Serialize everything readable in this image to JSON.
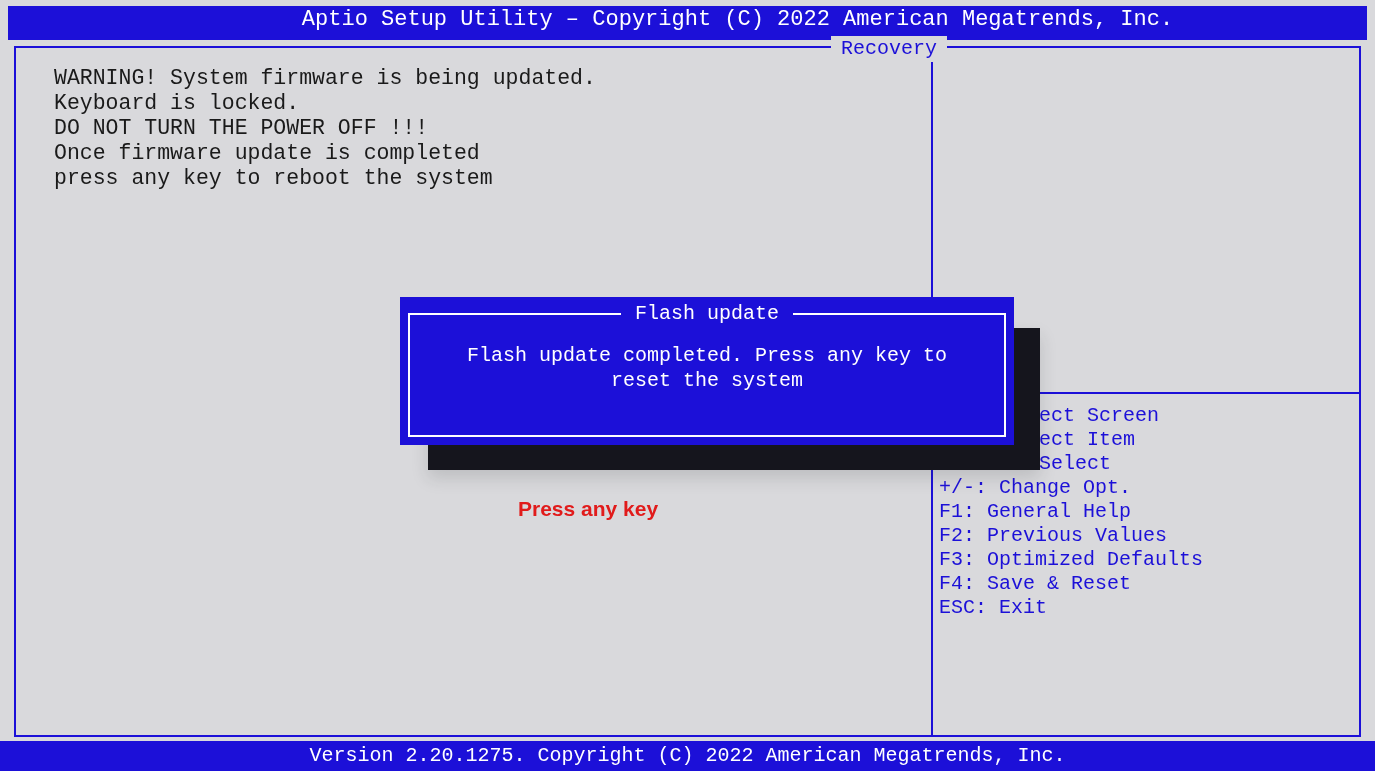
{
  "header": {
    "title": "Aptio Setup Utility – Copyright (C) 2022 American Megatrends, Inc.",
    "tabs": [
      {
        "label": "Recovery",
        "selected": true
      }
    ]
  },
  "message_lines": [
    "WARNING! System firmware is being updated.",
    "Keyboard is locked.",
    "DO NOT TURN THE POWER OFF !!!",
    "Once firmware update is completed",
    "press any key to reboot the system"
  ],
  "help_keys": [
    {
      "text": "ect Screen",
      "covered": true
    },
    {
      "text": "ect Item",
      "covered": true
    },
    {
      "text": "Select",
      "covered": true
    },
    {
      "text": "+/-: Change Opt.",
      "covered": false
    },
    {
      "text": "F1: General Help",
      "covered": false
    },
    {
      "text": "F2: Previous Values",
      "covered": false
    },
    {
      "text": "F3: Optimized Defaults",
      "covered": false
    },
    {
      "text": "F4: Save & Reset",
      "covered": false
    },
    {
      "text": "ESC: Exit",
      "covered": false
    }
  ],
  "dialog": {
    "title": "Flash update",
    "message": "Flash update completed. Press any key to reset the system"
  },
  "annotation": "Press any key",
  "footer": "Version 2.20.1275. Copyright (C) 2022 American Megatrends, Inc."
}
